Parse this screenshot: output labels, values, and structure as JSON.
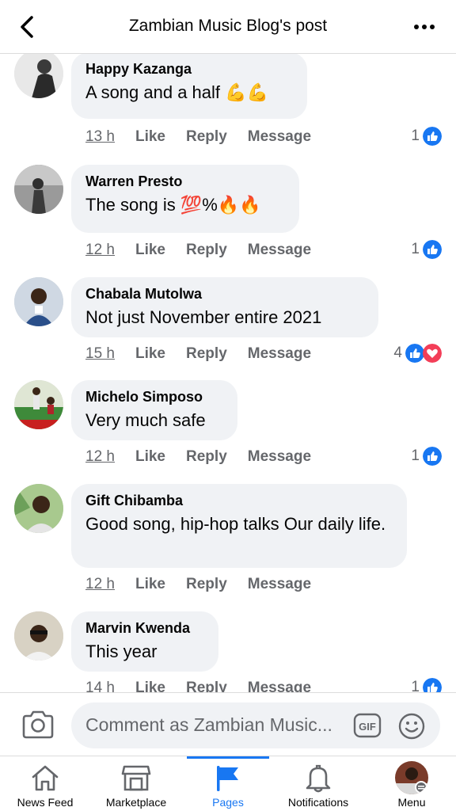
{
  "header": {
    "title": "Zambian Music Blog's post"
  },
  "comments": [
    {
      "author": "Happy Kazanga",
      "text": "A song and a half 💪💪",
      "time": "13 h",
      "like": "Like",
      "reply": "Reply",
      "message": "Message",
      "reaction_count": "1"
    },
    {
      "author": "Warren Presto",
      "text": "The song is 💯%🔥🔥",
      "time": "12 h",
      "like": "Like",
      "reply": "Reply",
      "message": "Message",
      "reaction_count": "1"
    },
    {
      "author": "Chabala Mutolwa",
      "text": "Not just November  entire  2021",
      "time": "15 h",
      "like": "Like",
      "reply": "Reply",
      "message": "Message",
      "reaction_count": "4"
    },
    {
      "author": "Michelo Simposo",
      "text": "Very much safe",
      "time": "12 h",
      "like": "Like",
      "reply": "Reply",
      "message": "Message",
      "reaction_count": "1"
    },
    {
      "author": "Gift Chibamba",
      "text": "Good song, hip-hop talks Our daily life.",
      "time": "12 h",
      "like": "Like",
      "reply": "Reply",
      "message": "Message",
      "reaction_count": ""
    },
    {
      "author": "Marvin Kwenda",
      "text": "This year",
      "time": "14 h",
      "like": "Like",
      "reply": "Reply",
      "message": "Message",
      "reaction_count": "1"
    }
  ],
  "composer": {
    "placeholder": "Comment as Zambian Music..."
  },
  "nav": {
    "news_feed": "News Feed",
    "marketplace": "Marketplace",
    "pages": "Pages",
    "notifications": "Notifications",
    "menu": "Menu"
  },
  "colors": {
    "accent": "#1877f2",
    "love": "#f33e58",
    "bubble": "#f0f2f5",
    "muted": "#65676b"
  },
  "icons": [
    "back-arrow-icon",
    "more-icon",
    "like-reaction-icon",
    "love-reaction-icon",
    "camera-icon",
    "gif-icon",
    "emoji-icon",
    "home-icon",
    "marketplace-icon",
    "flag-icon",
    "bell-icon"
  ]
}
